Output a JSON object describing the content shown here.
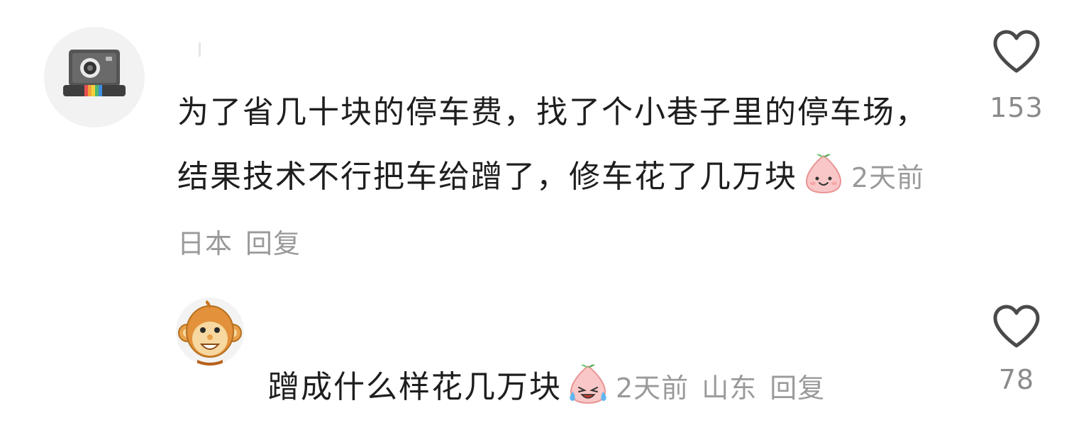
{
  "comments": [
    {
      "avatar_icon": "retro-camera-icon",
      "text": "为了省几十块的停车费，找了个小巷子里的停车场，结果技术不行把车给蹭了，修车花了几万块",
      "emoji": "smiling-peach-emoji",
      "time": "2天前",
      "location": "日本",
      "reply_label": "回复",
      "like_icon": "heart-outline-icon",
      "like_count": "153"
    },
    {
      "avatar_icon": "monkey-face-icon",
      "text": "蹭成什么样花几万块",
      "emoji": "crying-laughing-peach-emoji",
      "time": "2天前",
      "location": "山东",
      "reply_label": "回复",
      "like_icon": "heart-outline-icon",
      "like_count": "78"
    }
  ],
  "colors": {
    "text": "#1e1e1e",
    "meta": "#9a9a9a",
    "like_count": "#8a8a8a",
    "icon_stroke": "#4a4a4a"
  }
}
